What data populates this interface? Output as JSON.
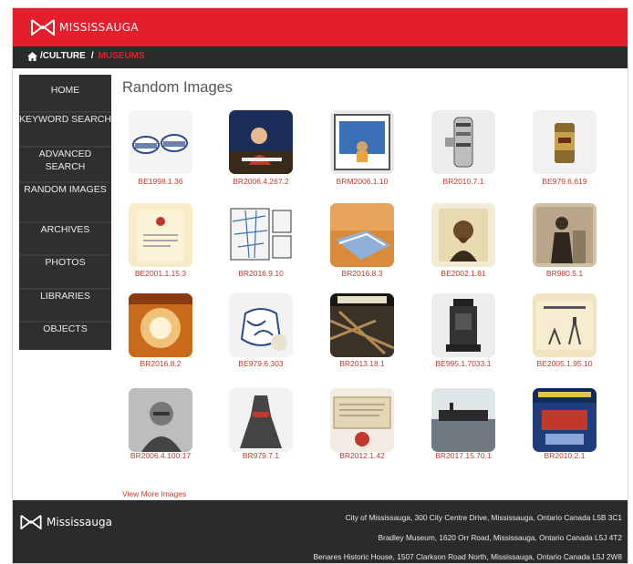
{
  "brand": {
    "name": "MISSISSAUGA",
    "accent": "#e51e2b",
    "dark": "#2b2b2b"
  },
  "breadcrumb": {
    "home_icon": "home-icon",
    "culture": "/CULTURE",
    "sep": "/",
    "current": "MUSEUMS"
  },
  "sidebar": {
    "items": [
      {
        "label": "HOME"
      },
      {
        "label": "KEYWORD SEARCH"
      },
      {
        "label": "ADVANCED SEARCH"
      },
      {
        "label": "RANDOM IMAGES"
      },
      {
        "label": "ARCHIVES"
      },
      {
        "label": "PHOTOS"
      },
      {
        "label": "LIBRARIES"
      },
      {
        "label": "OBJECTS"
      }
    ]
  },
  "main": {
    "title": "Random Images",
    "images": [
      {
        "id": "BE1998.1.36"
      },
      {
        "id": "BR2006.4.267.2"
      },
      {
        "id": "BRM2006.1.10"
      },
      {
        "id": "BR2010.7.1"
      },
      {
        "id": "BE979.6.619"
      },
      {
        "id": "BE2001.1.15.3"
      },
      {
        "id": "BR2016.9.10"
      },
      {
        "id": "BR2016.8.3"
      },
      {
        "id": "BE2002.1.81"
      },
      {
        "id": "BR980.5.1"
      },
      {
        "id": "BR2016.8.2"
      },
      {
        "id": "BE979.6.303"
      },
      {
        "id": "BR2013.18.1"
      },
      {
        "id": "BE995.1.7033.1"
      },
      {
        "id": "BE2005.1.95.10"
      },
      {
        "id": "BR2006.4.100.17"
      },
      {
        "id": "BR979.7.1"
      },
      {
        "id": "BR2012.1.42"
      },
      {
        "id": "BR2017.15.70.1"
      },
      {
        "id": "BR2010.2.1"
      }
    ],
    "view_more": "View More Images"
  },
  "footer": {
    "brand": "Mississauga",
    "addresses": [
      "City of Mississauga, 300 City Centre Drive, Mississauga, Ontario Canada L5B 3C1",
      "Bradley Museum, 1620 Orr Road, Mississauga, Ontario Canada L5J 4T2",
      "Benares Historic House, 1507 Clarkson Road North, Mississauga, Ontario Canada L5J 2W8"
    ]
  }
}
